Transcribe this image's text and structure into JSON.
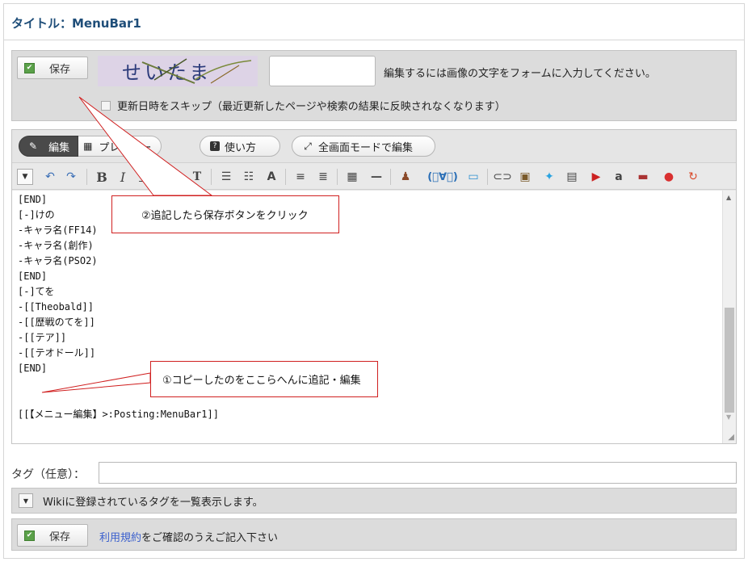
{
  "title": "タイトル：MenuBar1",
  "captcha": {
    "save_label": "保存",
    "image_text": "せいたま",
    "message": "編集するには画像の文字をフォームに入力してください。",
    "skip_label": "更新日時をスキップ（最近更新したページや検索の結果に反映されなくなります）"
  },
  "mode_tabs": {
    "edit": "編集",
    "preview": "プレビュー",
    "howto": "使い方",
    "fullscreen": "全画面モードで編集"
  },
  "editor_lines": [
    "[END]",
    "[-]けの",
    "-キャラ名(FF14)",
    "-キャラ名(創作)",
    "-キャラ名(PSO2)",
    "[END]",
    "[-]てを",
    "-[[Theobald]]",
    "-[[歴戦のてを]]",
    "-[[テア]]",
    "-[[テオドール]]",
    "[END]",
    "",
    "",
    "[[【メニュー編集】>:Posting:MenuBar1]]"
  ],
  "callouts": {
    "save_hint": "②追記したら保存ボタンをクリック",
    "edit_hint": "①コピーしたのをここらへんに追記・編集"
  },
  "tags": {
    "label": "タグ（任意）：",
    "list_text": "Wikiに登録されているタグを一覧表示します。"
  },
  "bottom": {
    "save_label": "保存",
    "terms_link": "利用規約",
    "terms_rest": "をご確認のうえご記入下さい"
  }
}
